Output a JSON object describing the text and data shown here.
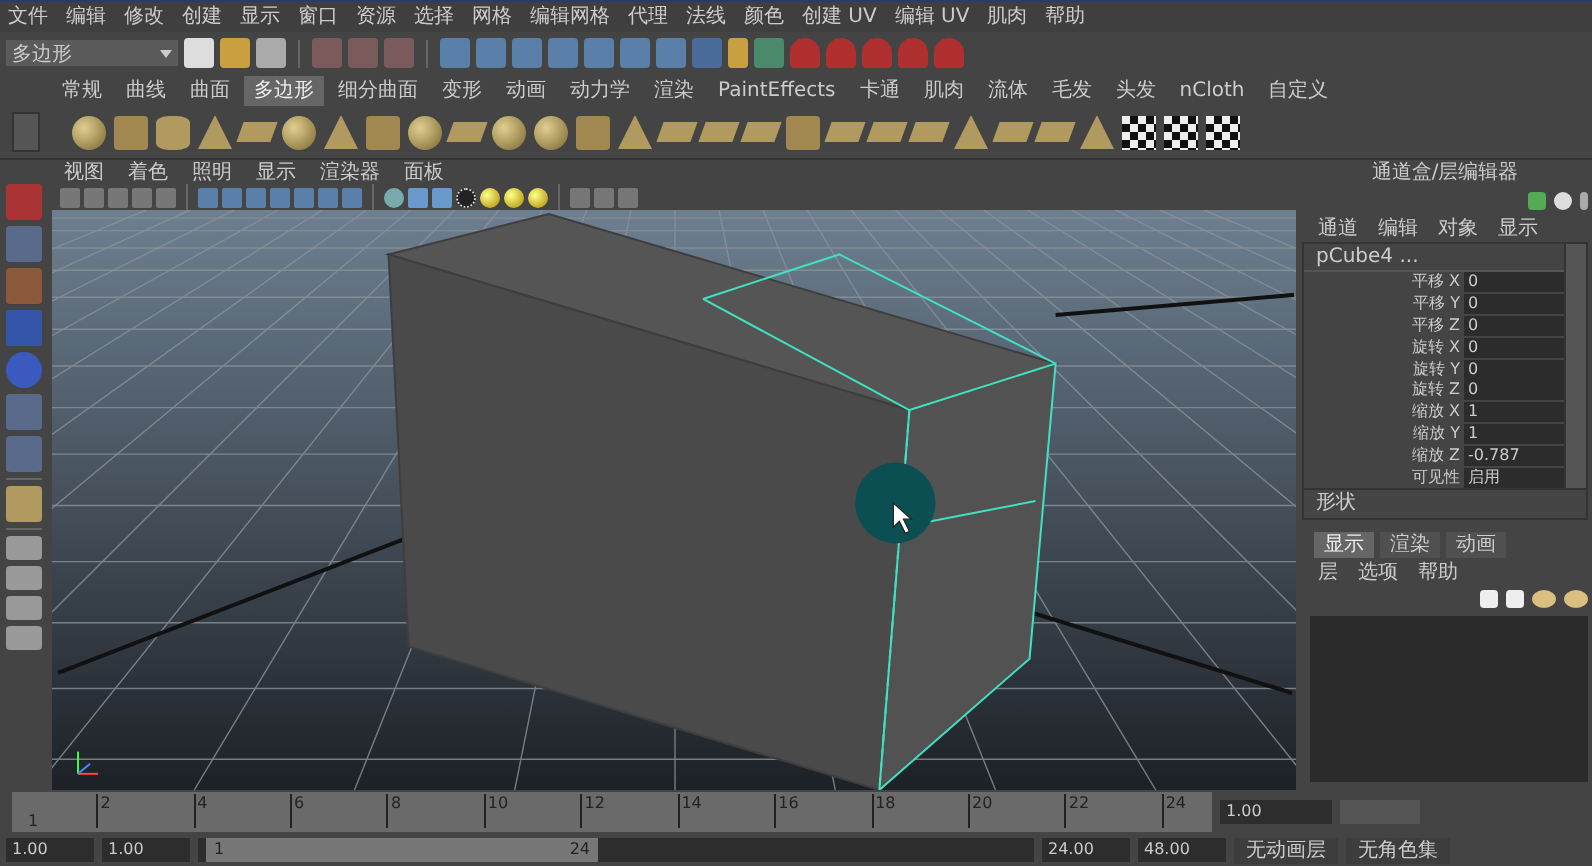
{
  "menu_bar": [
    "文件",
    "编辑",
    "修改",
    "创建",
    "显示",
    "窗口",
    "资源",
    "选择",
    "网格",
    "编辑网格",
    "代理",
    "法线",
    "颜色",
    "创建 UV",
    "编辑 UV",
    "肌肉",
    "帮助"
  ],
  "mode_selector": {
    "value": "多边形"
  },
  "shelf_tabs": [
    {
      "label": "常规",
      "selected": false
    },
    {
      "label": "曲线",
      "selected": false
    },
    {
      "label": "曲面",
      "selected": false
    },
    {
      "label": "多边形",
      "selected": true
    },
    {
      "label": "细分曲面",
      "selected": false
    },
    {
      "label": "变形",
      "selected": false
    },
    {
      "label": "动画",
      "selected": false
    },
    {
      "label": "动力学",
      "selected": false
    },
    {
      "label": "渲染",
      "selected": false
    },
    {
      "label": "PaintEffects",
      "selected": false
    },
    {
      "label": "卡通",
      "selected": false
    },
    {
      "label": "肌肉",
      "selected": false
    },
    {
      "label": "流体",
      "selected": false
    },
    {
      "label": "毛发",
      "selected": false
    },
    {
      "label": "头发",
      "selected": false
    },
    {
      "label": "nCloth",
      "selected": false
    },
    {
      "label": "自定义",
      "selected": false
    }
  ],
  "viewport": {
    "menu": [
      "视图",
      "着色",
      "照明",
      "显示",
      "渲染器",
      "面板"
    ]
  },
  "channel_box": {
    "title": "通道盒/层编辑器",
    "menu": [
      "通道",
      "编辑",
      "对象",
      "显示"
    ],
    "object": "pCube4 ...",
    "attributes": [
      {
        "label": "平移 X",
        "value": "0"
      },
      {
        "label": "平移 Y",
        "value": "0"
      },
      {
        "label": "平移 Z",
        "value": "0"
      },
      {
        "label": "旋转 X",
        "value": "0"
      },
      {
        "label": "旋转 Y",
        "value": "0"
      },
      {
        "label": "旋转 Z",
        "value": "0"
      },
      {
        "label": "缩放 X",
        "value": "1"
      },
      {
        "label": "缩放 Y",
        "value": "1"
      },
      {
        "label": "缩放 Z",
        "value": "-0.787"
      },
      {
        "label": "可见性",
        "value": "启用"
      }
    ],
    "section": "形状"
  },
  "layer_editor": {
    "tabs": [
      {
        "label": "显示",
        "selected": true
      },
      {
        "label": "渲染",
        "selected": false
      },
      {
        "label": "动画",
        "selected": false
      }
    ],
    "menu": [
      "层",
      "选项",
      "帮助"
    ]
  },
  "timeline": {
    "current_frame": "1",
    "ticks": [
      "2",
      "4",
      "6",
      "8",
      "10",
      "12",
      "14",
      "16",
      "18",
      "20",
      "22",
      "24"
    ],
    "current_time": "1.00"
  },
  "range_slider": {
    "start_time": "1.00",
    "playback_start": "1.00",
    "range_start": "1",
    "range_end": "24",
    "playback_end": "24.00",
    "end_time": "48.00",
    "anim_layer": "无动画层",
    "character_set": "无角色集"
  }
}
